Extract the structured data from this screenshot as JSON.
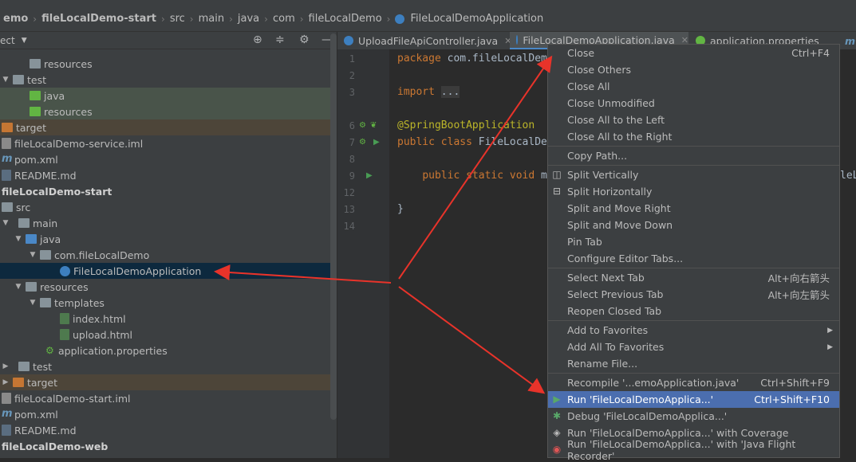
{
  "breadcrumb": {
    "items": [
      "emo",
      "fileLocalDemo-start",
      "src",
      "main",
      "java",
      "com",
      "fileLocalDemo",
      "FileLocalDemoApplication"
    ]
  },
  "project_panel": {
    "title": "ect",
    "rows": [
      {
        "label": "resources",
        "type": "folder"
      },
      {
        "label": "test",
        "type": "folder"
      },
      {
        "label": "java",
        "type": "folder-green"
      },
      {
        "label": "resources",
        "type": "folder-green"
      },
      {
        "label": "target",
        "type": "folder-orange"
      },
      {
        "label": "fileLocalDemo-service.iml",
        "type": "iml"
      },
      {
        "label": "pom.xml",
        "type": "xml"
      },
      {
        "label": "README.md",
        "type": "md"
      },
      {
        "label": "fileLocalDemo-start",
        "type": "module"
      },
      {
        "label": "src",
        "type": "folder"
      },
      {
        "label": "main",
        "type": "folder"
      },
      {
        "label": "java",
        "type": "folder-blue"
      },
      {
        "label": "com.fileLocalDemo",
        "type": "package"
      },
      {
        "label": "FileLocalDemoApplication",
        "type": "class"
      },
      {
        "label": "resources",
        "type": "folder"
      },
      {
        "label": "templates",
        "type": "folder"
      },
      {
        "label": "index.html",
        "type": "html"
      },
      {
        "label": "upload.html",
        "type": "html"
      },
      {
        "label": "application.properties",
        "type": "properties"
      },
      {
        "label": "test",
        "type": "folder"
      },
      {
        "label": "target",
        "type": "folder-orange"
      },
      {
        "label": "fileLocalDemo-start.iml",
        "type": "iml"
      },
      {
        "label": "pom.xml",
        "type": "xml"
      },
      {
        "label": "README.md",
        "type": "md"
      },
      {
        "label": "fileLocalDemo-web",
        "type": "module"
      }
    ]
  },
  "editor": {
    "tabs": [
      "UploadFileApiController.java",
      "FileLocalDemoApplication.java",
      "application.properties"
    ],
    "line_numbers": [
      "1",
      "2",
      "3",
      "6",
      "7",
      "8",
      "9",
      "12",
      "13",
      "14"
    ],
    "code": {
      "l1_kw": "package",
      "l1_rest": " com.fileLocalDem",
      "l3_kw": "import",
      "l3_fold": "...",
      "l6_ann": "@SpringBootApplication",
      "l7_kw": "public class",
      "l7_rest": " FileLocalDe",
      "l9_kw": "public static void",
      "l9_rest": " m",
      "l9_tail": "leL",
      "l13": "}"
    }
  },
  "context_menu": {
    "items": [
      {
        "label": "Close",
        "shortcut": "Ctrl+F4"
      },
      {
        "label": "Close Others",
        "shortcut": ""
      },
      {
        "label": "Close All",
        "shortcut": ""
      },
      {
        "label": "Close Unmodified",
        "shortcut": ""
      },
      {
        "label": "Close All to the Left",
        "shortcut": ""
      },
      {
        "label": "Close All to the Right",
        "shortcut": ""
      },
      {
        "label": "Copy Path...",
        "shortcut": ""
      },
      {
        "label": "Split Vertically",
        "shortcut": ""
      },
      {
        "label": "Split Horizontally",
        "shortcut": ""
      },
      {
        "label": "Split and Move Right",
        "shortcut": ""
      },
      {
        "label": "Split and Move Down",
        "shortcut": ""
      },
      {
        "label": "Pin Tab",
        "shortcut": ""
      },
      {
        "label": "Configure Editor Tabs...",
        "shortcut": ""
      },
      {
        "label": "Select Next Tab",
        "shortcut": "Alt+向右箭头"
      },
      {
        "label": "Select Previous Tab",
        "shortcut": "Alt+向左箭头"
      },
      {
        "label": "Reopen Closed Tab",
        "shortcut": ""
      },
      {
        "label": "Add to Favorites",
        "shortcut": ""
      },
      {
        "label": "Add All To Favorites",
        "shortcut": ""
      },
      {
        "label": "Rename File...",
        "shortcut": ""
      },
      {
        "label": "Recompile '...emoApplication.java'",
        "shortcut": "Ctrl+Shift+F9"
      },
      {
        "label": "Run 'FileLocalDemoApplica...'",
        "shortcut": "Ctrl+Shift+F10"
      },
      {
        "label": "Debug 'FileLocalDemoApplica...'",
        "shortcut": ""
      },
      {
        "label": "Run 'FileLocalDemoApplica...' with Coverage",
        "shortcut": ""
      },
      {
        "label": "Run 'FileLocalDemoApplica...' with 'Java Flight Recorder'",
        "shortcut": ""
      }
    ]
  },
  "colors": {
    "highlight": "#4b6eaf",
    "annotation_arrow": "#e8332a",
    "selected_row": "#0d293e"
  }
}
